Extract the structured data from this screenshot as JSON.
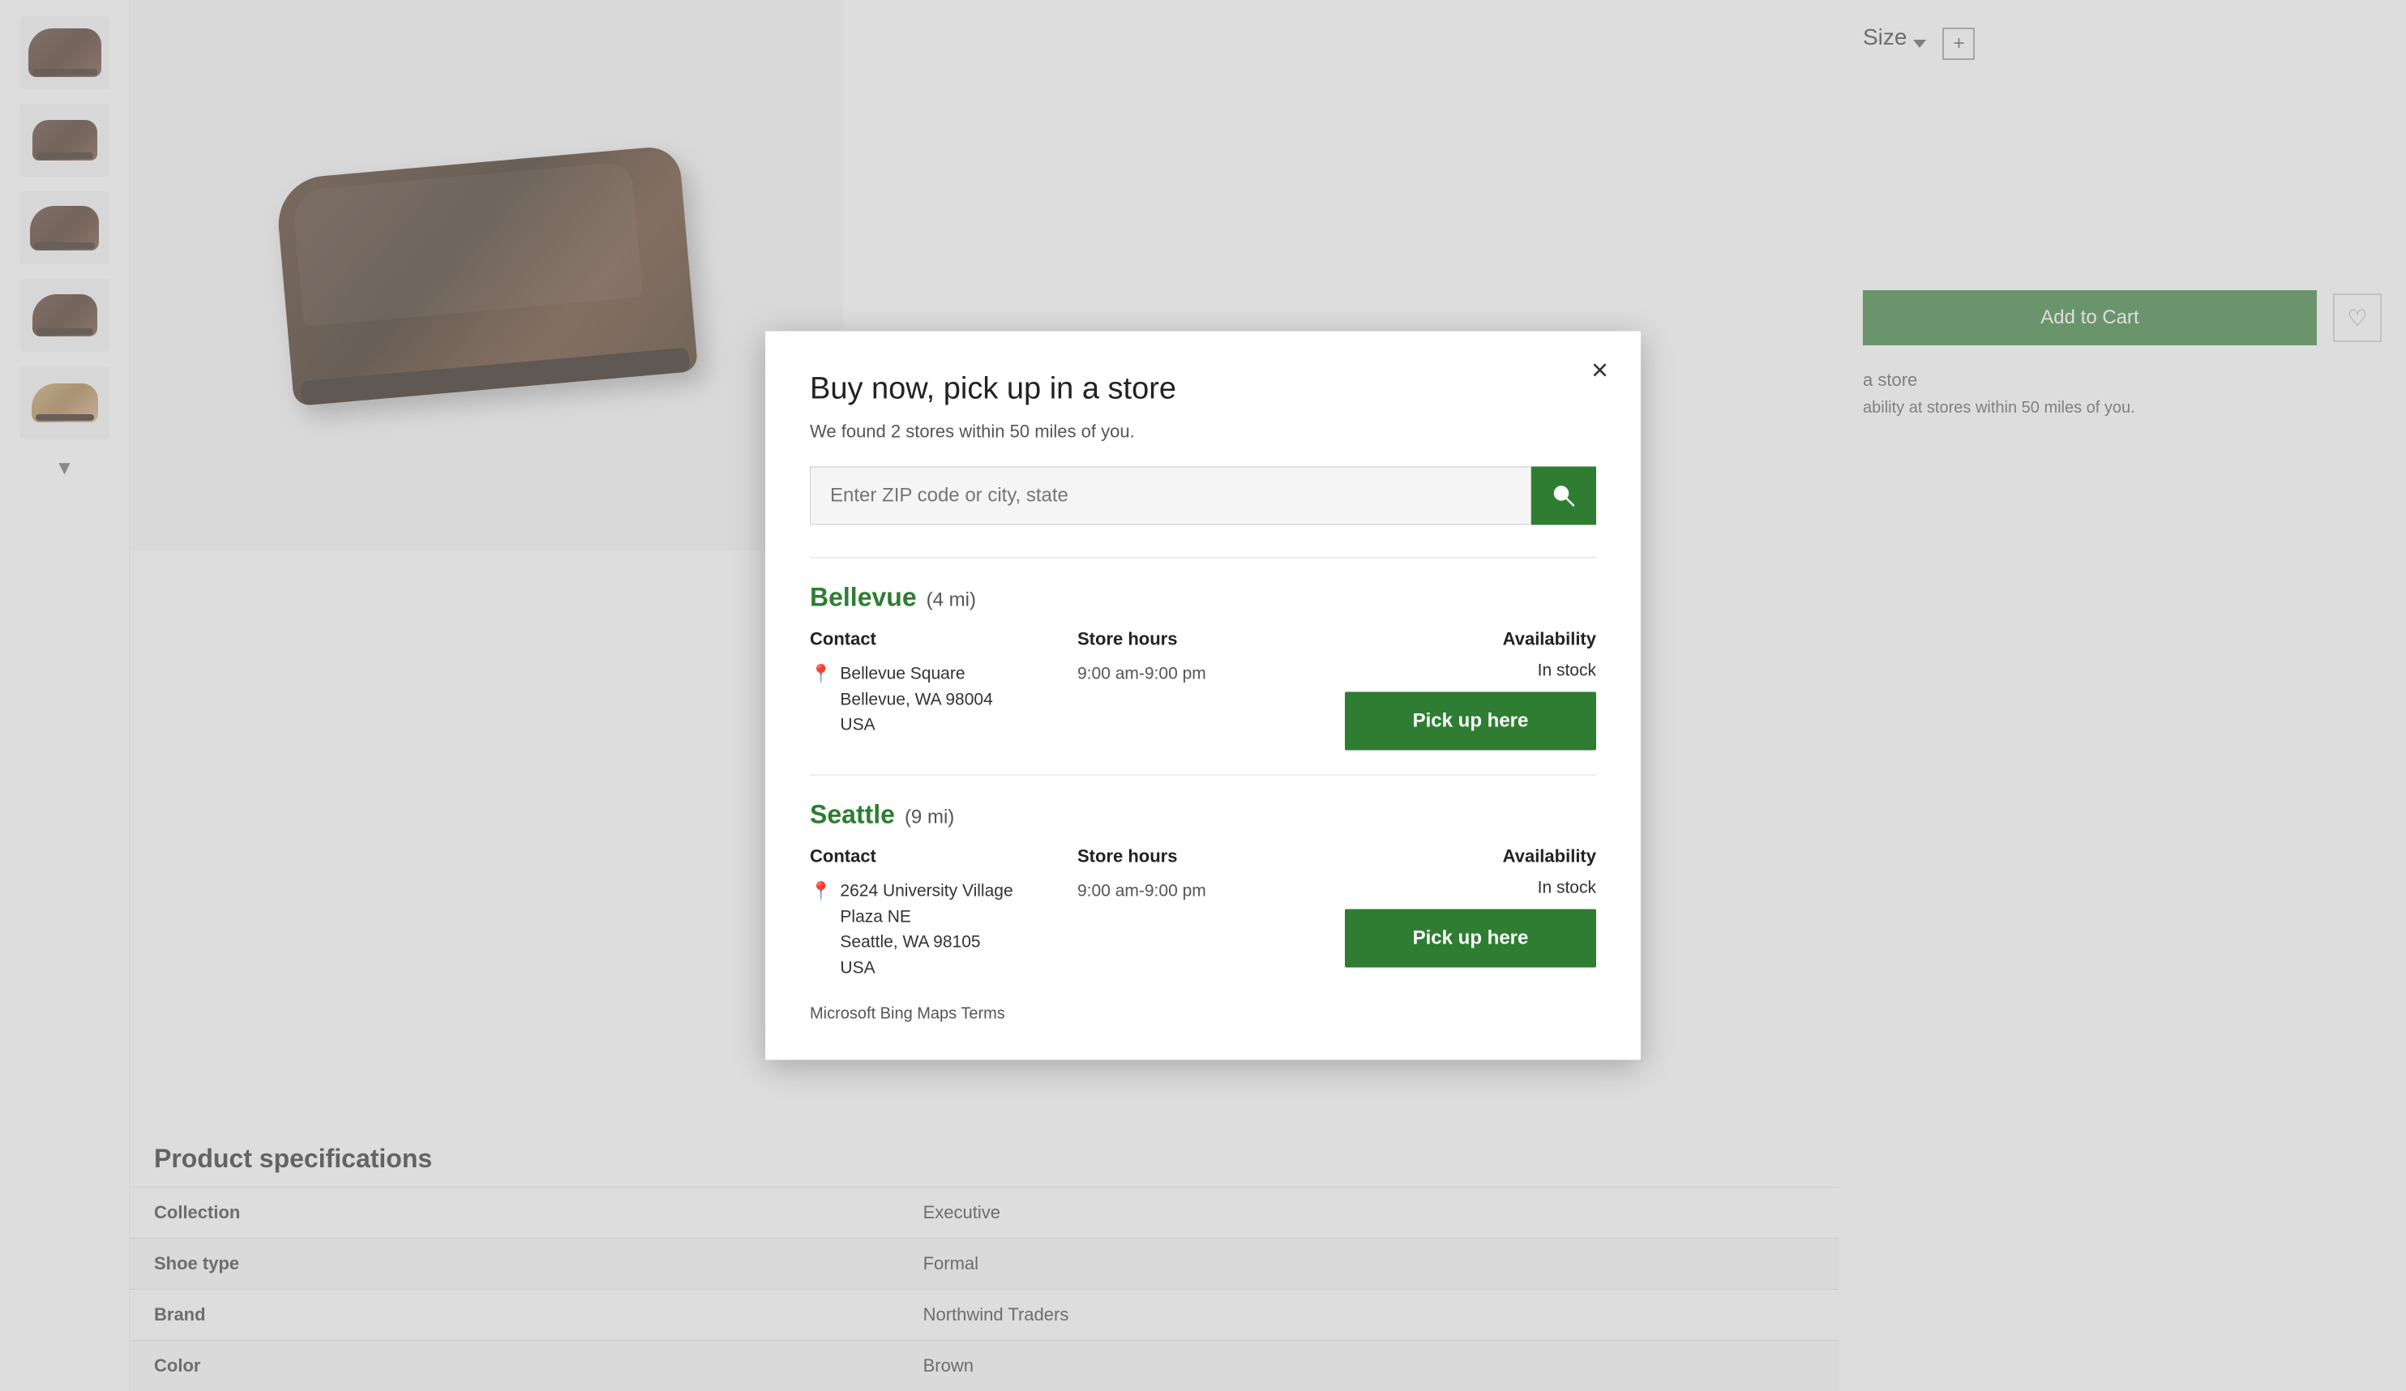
{
  "sidebar": {
    "chevron_label": "▼"
  },
  "right_panel": {
    "size_label": "Size",
    "add_to_cart_label": "Add to Cart",
    "store_text": "a store",
    "availability_text": "ability at stores within 50 miles of you."
  },
  "specs": {
    "title": "Product specifications",
    "rows": [
      {
        "label": "Collection",
        "value": "Executive"
      },
      {
        "label": "Shoe type",
        "value": "Formal"
      },
      {
        "label": "Brand",
        "value": "Northwind Traders"
      },
      {
        "label": "Color",
        "value": "Brown"
      }
    ]
  },
  "modal": {
    "title": "Buy now, pick up in a store",
    "subtitle": "We found 2 stores within 50 miles of you.",
    "close_label": "×",
    "search_placeholder": "Enter ZIP code or city, state",
    "stores": [
      {
        "name": "Bellevue",
        "distance": "(4 mi)",
        "contact_header": "Contact",
        "address_line1": "Bellevue Square",
        "address_line2": "Bellevue, WA 98004",
        "address_line3": "USA",
        "hours_header": "Store hours",
        "hours": "9:00 am-9:00 pm",
        "availability_header": "Availability",
        "availability_status": "In stock",
        "pickup_label": "Pick up here"
      },
      {
        "name": "Seattle",
        "distance": "(9 mi)",
        "contact_header": "Contact",
        "address_line1": "2624 University Village",
        "address_line2": "Plaza NE",
        "address_line3": "Seattle, WA 98105",
        "address_line4": "USA",
        "hours_header": "Store hours",
        "hours": "9:00 am-9:00 pm",
        "availability_header": "Availability",
        "availability_status": "In stock",
        "pickup_label": "Pick up here"
      }
    ],
    "bing_terms": "Microsoft Bing Maps Terms"
  },
  "colors": {
    "green": "#2e7d32",
    "text_dark": "#222",
    "text_muted": "#555"
  }
}
